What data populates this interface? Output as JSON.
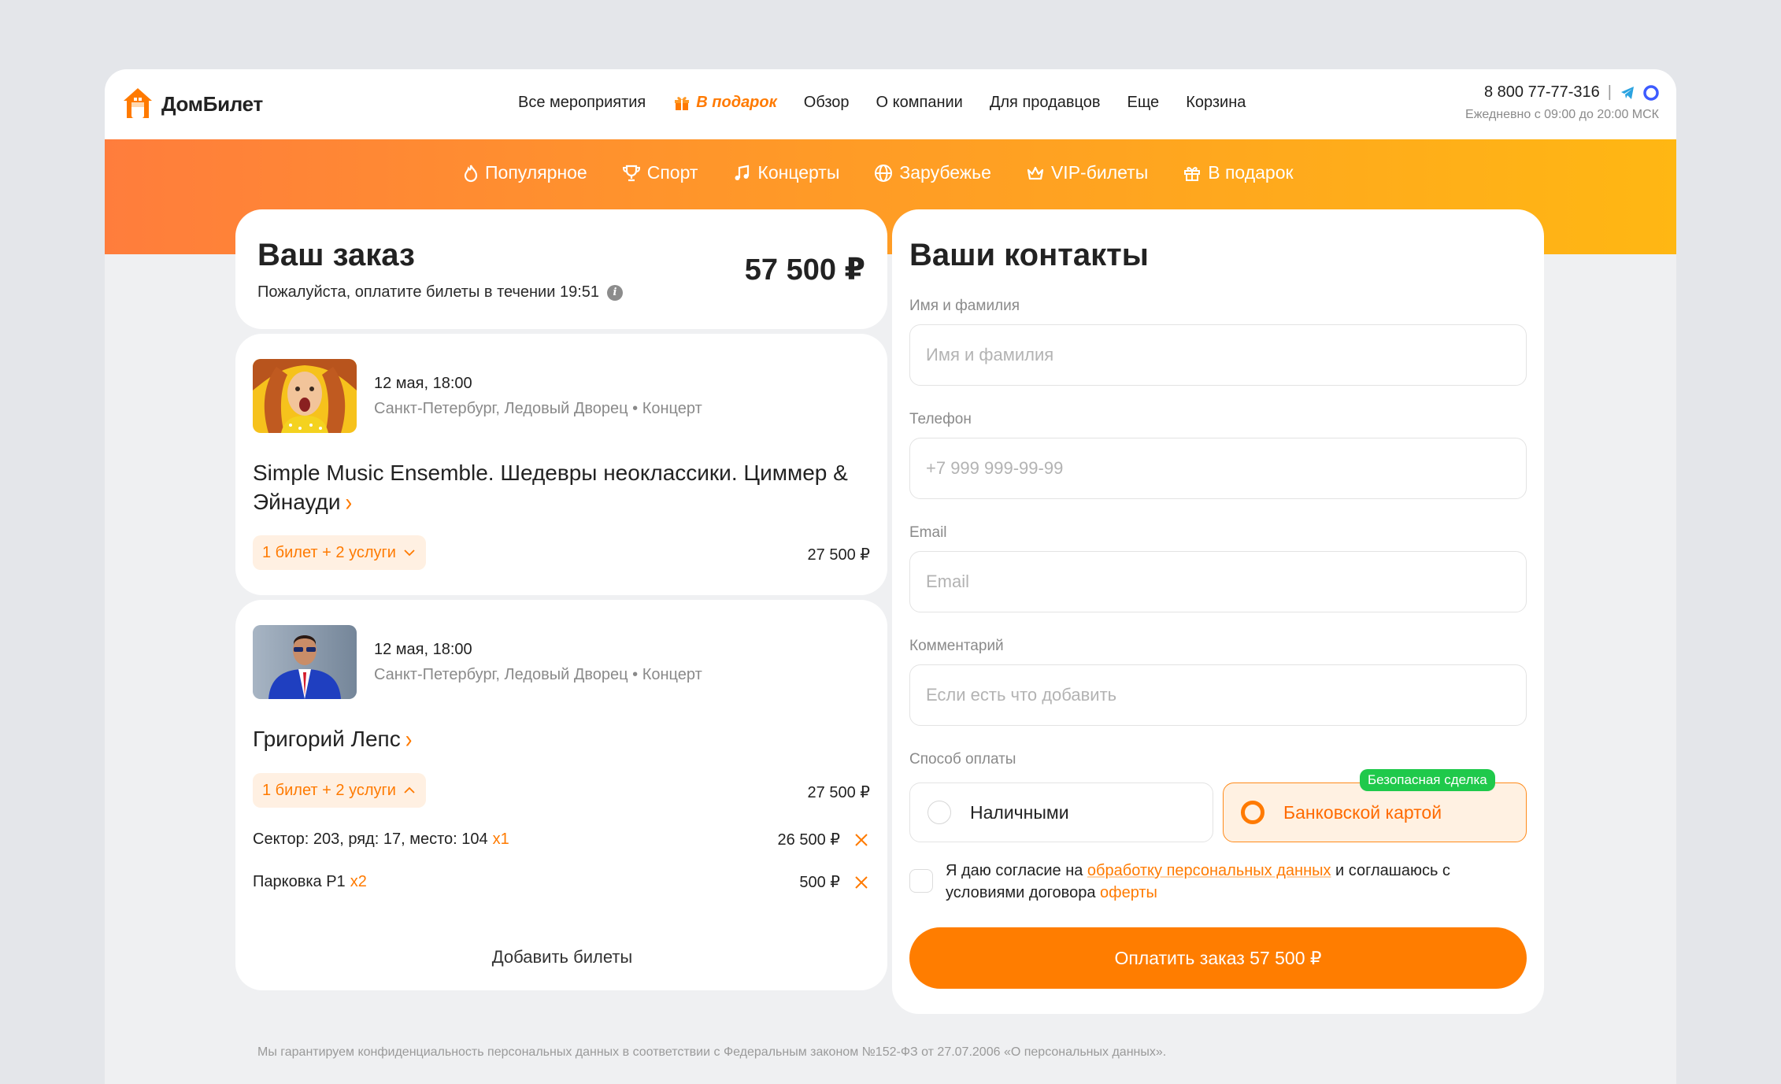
{
  "brand": {
    "name": "ДомБилет",
    "accent": "#ff7a00"
  },
  "nav": {
    "items": [
      "Все мероприятия",
      "В подарок",
      "Обзор",
      "О компании",
      "Для продавцов",
      "Еще",
      "Корзина"
    ]
  },
  "contact": {
    "phone": "8 800 77-77-316",
    "separator": "|",
    "hours": "Ежедневно с 09:00 до 20:00 МСК"
  },
  "categories": [
    "Популярное",
    "Спорт",
    "Концерты",
    "Зарубежье",
    "VIP-билеты",
    "В подарок"
  ],
  "order": {
    "title": "Ваш заказ",
    "subtitle": "Пожалуйста, оплатите билеты в течении 19:51",
    "info_icon": "i",
    "total": "57 500 ₽"
  },
  "events": [
    {
      "date": "12 мая, 18:00",
      "place": "Санкт-Петербург, Ледовый Дворец • Концерт",
      "title": "Simple Music Ensemble. Шедевры неоклассики. Циммер & Эйнауди",
      "chevron": "›",
      "summary": "1 билет + 2 услуги",
      "price": "27 500 ₽"
    },
    {
      "date": "12 мая, 18:00",
      "place": "Санкт-Петербург, Ледовый Дворец • Концерт",
      "title": "Григорий Лепс",
      "chevron": "›",
      "summary": "1 билет + 2 услуги",
      "price": "27 500 ₽",
      "lines": [
        {
          "label": "Сектор: 203, ряд: 17, место: 104",
          "qty": "x1",
          "price": "26 500 ₽"
        },
        {
          "label": "Парковка P1",
          "qty": "x2",
          "price": "500 ₽"
        }
      ]
    }
  ],
  "add_tickets": "Добавить билеты",
  "contacts": {
    "title": "Ваши контакты",
    "fields": {
      "name": {
        "label": "Имя и фамилия",
        "placeholder": "Имя и фамилия"
      },
      "phone": {
        "label": "Телефон",
        "placeholder": "+7 999 999-99-99"
      },
      "email": {
        "label": "Email",
        "placeholder": "Email"
      },
      "comment": {
        "label": "Комментарий",
        "placeholder": "Если есть что добавить"
      }
    },
    "payment": {
      "label": "Способ оплаты",
      "cash": "Наличными",
      "card": "Банковской картой",
      "badge": "Безопасная сделка",
      "selected": "card"
    },
    "agree": {
      "text1": "Я даю согласие на ",
      "link1": "обработку персональных данных",
      "text2": " и соглашаюсь с условиями договора ",
      "link2": "оферты"
    },
    "pay_button": "Оплатить заказ 57 500 ₽"
  },
  "footnote": "Мы гарантируем конфиденциальность персональных данных в соответствии с Федеральным законом №152-ФЗ от 27.07.2006 «О персональных данных».",
  "colors": {
    "accent": "#ff7a00",
    "band_start": "#ff7d3c",
    "band_end": "#ffb713",
    "badge": "#1fc94b",
    "telegram": "#2aa3e0",
    "max": "#3d5bff"
  }
}
